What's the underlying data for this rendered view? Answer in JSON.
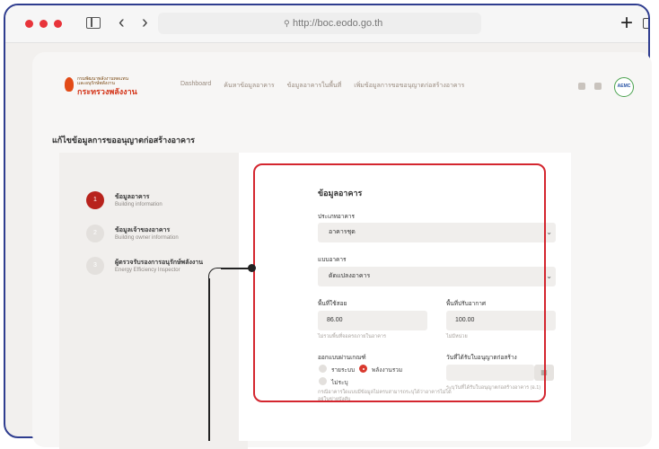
{
  "browser": {
    "url": "http://boc.eodo.go.th",
    "new_tab_icon": "plus-icon",
    "copy_icon": "copy-icon"
  },
  "app": {
    "logo": {
      "line1": "กรมพัฒนาพลังงานทดแทน",
      "line2": "และอนุรักษ์พลังงาน",
      "line3": "กระทรวงพลังงาน"
    },
    "nav": [
      "Dashboard",
      "ค้นหาข้อมูลอาคาร",
      "ข้อมูลอาคารในพื้นที่",
      "เพิ่มข้อมูลการขอขอนุญาตก่อสร้างอาคาร"
    ],
    "avatar_text": "AEMC",
    "page_title": "แก้ไขข้อมูลการขออนุญาตก่อสร้างอาคาร"
  },
  "steps": [
    {
      "num": "1",
      "title": "ข้อมูลอาคาร",
      "subtitle": "Building information",
      "active": true
    },
    {
      "num": "2",
      "title": "ข้อมูลเจ้าของอาคาร",
      "subtitle": "Building owner information",
      "active": false
    },
    {
      "num": "3",
      "title": "ผู้ตรวจรับรองการอนุรักษ์พลังงาน",
      "subtitle": "Energy Efficiency Inspector",
      "active": false
    }
  ],
  "form": {
    "section_title": "ข้อมูลอาคาร",
    "building_type_label": "ประเภทอาคาร",
    "building_type_value": "อาคารชุด",
    "building_form_label": "แบบอาคาร",
    "building_form_value": "ดัดแปลงอาคาร",
    "usable_area_label": "พื้นที่ใช้สอย",
    "usable_area_value": "86.00",
    "usable_area_hint": "ไม่รวมพื้นที่จอดรถภายในอาคาร",
    "conditioned_area_label": "พื้นที่ปรับอากาศ",
    "conditioned_area_value": "100.00",
    "conditioned_area_hint": "ไม่มีหน่วย",
    "design_label": "ออกแบบผ่านเกณฑ์",
    "radio_options": [
      "รายระบบ",
      "พลังงานรวม",
      "ไม่ระบุ"
    ],
    "selected_option": "พลังงานรวม",
    "date_label": "วันที่ได้รับใบอนุญาตก่อสร้าง",
    "date_hint": "ระบุวันที่ได้รับใบอนุญาตก่อสร้างอาคาร (อ.1)",
    "note": "กรณีอาคารใดแบบมีข้อมูลไม่ครบสามารถระบุได้ว่าอาคารไม่ได้อยู่ในข่ายบังคับ"
  }
}
